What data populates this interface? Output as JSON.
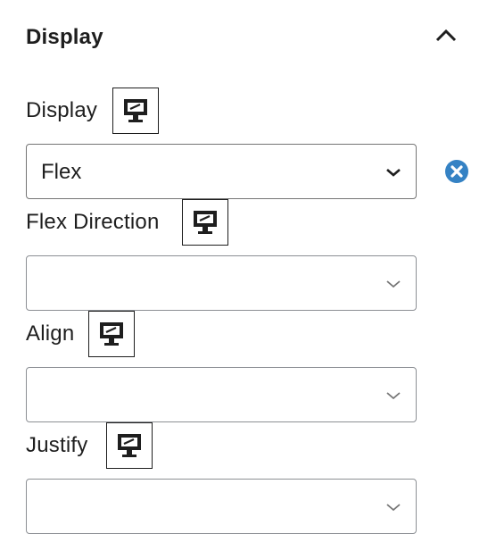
{
  "panel": {
    "title": "Display",
    "collapse_icon": "chevron-up-icon"
  },
  "fields": {
    "display": {
      "label": "Display",
      "value": "Flex",
      "device_icon": "desktop-icon",
      "clear_icon": "clear-circle-x-icon"
    },
    "flex_direction": {
      "label": "Flex Direction",
      "value": "",
      "device_icon": "desktop-icon"
    },
    "align": {
      "label": "Align",
      "value": "",
      "device_icon": "desktop-icon"
    },
    "justify": {
      "label": "Justify",
      "value": "",
      "device_icon": "desktop-icon"
    }
  },
  "colors": {
    "text": "#1e1e1e",
    "border": "#8c8f94",
    "clear_icon": "#3582c4"
  }
}
